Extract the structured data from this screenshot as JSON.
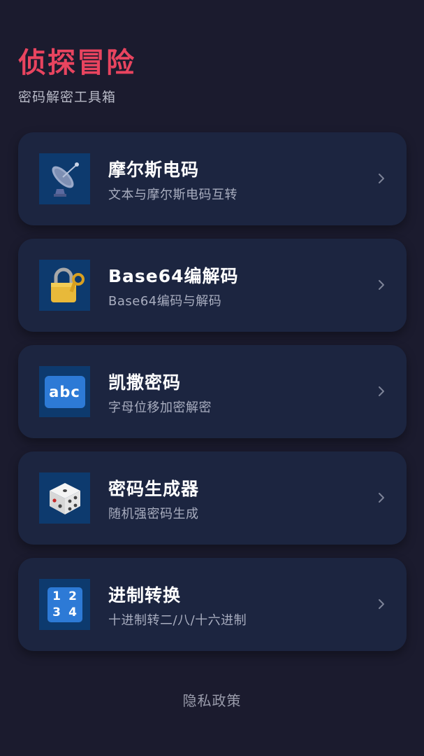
{
  "header": {
    "title": "侦探冒险",
    "subtitle": "密码解密工具箱"
  },
  "colors": {
    "title_accent": "#e8445f",
    "background": "#1b1b2e",
    "card_background": "#1c2540",
    "icon_tile": "#0d3a6e"
  },
  "tools": [
    {
      "title": "摩尔斯电码",
      "description": "文本与摩尔斯电码互转",
      "icon": "satellite-antenna-icon"
    },
    {
      "title": "Base64编解码",
      "description": "Base64编码与解码",
      "icon": "lock-with-key-icon"
    },
    {
      "title": "凯撒密码",
      "description": "字母位移加密解密",
      "icon": "abc-icon"
    },
    {
      "title": "密码生成器",
      "description": "随机强密码生成",
      "icon": "dice-icon"
    },
    {
      "title": "进制转换",
      "description": "十进制转二/八/十六进制",
      "icon": "numbers-1234-icon"
    }
  ],
  "icons": {
    "abc_label": "abc",
    "numbers": [
      "1",
      "2",
      "3",
      "4"
    ]
  },
  "footer": {
    "privacy_label": "隐私政策"
  }
}
